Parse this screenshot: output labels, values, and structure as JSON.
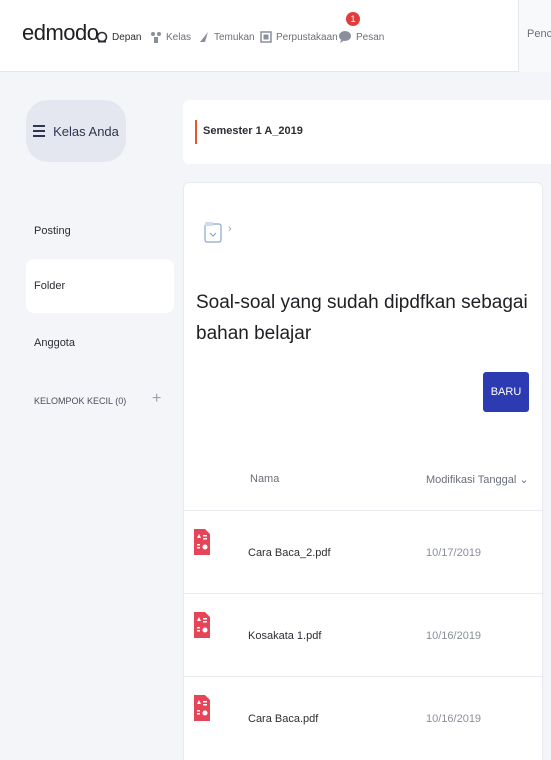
{
  "nav": {
    "logo": "edmodo",
    "items": [
      {
        "label": "Depan",
        "icon": "home-icon"
      },
      {
        "label": "Kelas",
        "icon": "class-icon"
      },
      {
        "label": "Temukan",
        "icon": "discover-icon"
      },
      {
        "label": "Perpustakaan",
        "icon": "library-icon"
      },
      {
        "label": "Pesan",
        "icon": "message-icon"
      }
    ],
    "message_badge": "1",
    "search_partial": "Penc"
  },
  "sidebar": {
    "class_button": "Kelas Anda",
    "items": [
      {
        "label": "Posting"
      },
      {
        "label": "Folder",
        "selected": true
      },
      {
        "label": "Anggota"
      },
      {
        "label": "KELOMPOK KECIL (0)"
      }
    ],
    "add_label": "+"
  },
  "main": {
    "class_name": "Semester 1 A_2019",
    "breadcrumb_chevron": "›",
    "folder_title": "Soal-soal yang sudah dipdfkan sebagai bahan belajar",
    "new_button": "BARU",
    "table": {
      "headers": {
        "name": "Nama",
        "date": "Modifikasi Tanggal ⌄"
      },
      "rows": [
        {
          "name": "Cara Baca_2.pdf",
          "date": "10/17/2019"
        },
        {
          "name": "Kosakata 1.pdf",
          "date": "10/16/2019"
        },
        {
          "name": "Cara Baca.pdf",
          "date": "10/16/2019"
        }
      ]
    }
  },
  "colors": {
    "accent_orange": "#e4582b",
    "primary_blue": "#2d3bb3",
    "pdf_red": "#e64557",
    "badge_red": "#e23b3b"
  }
}
